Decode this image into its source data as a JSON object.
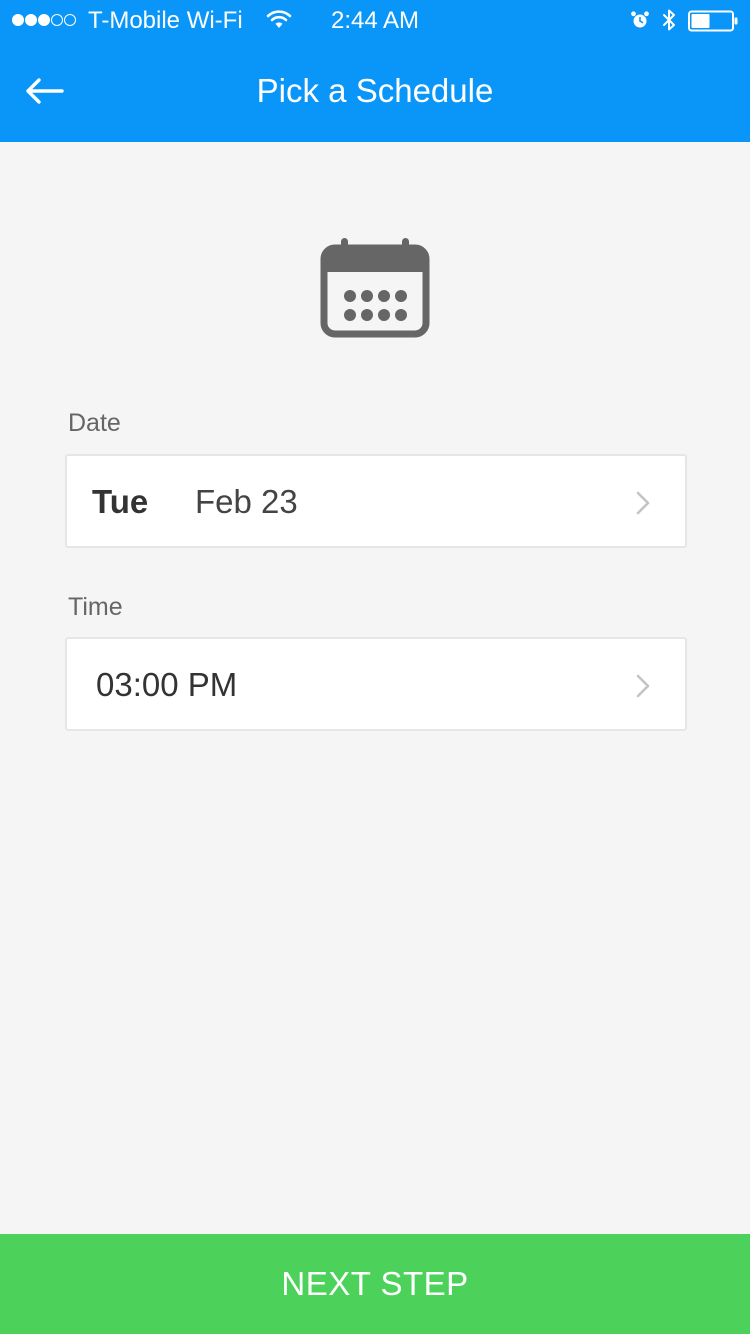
{
  "status_bar": {
    "carrier": "T-Mobile Wi-Fi",
    "time": "2:44 AM",
    "signal_dots_filled": 3,
    "signal_dots_total": 5
  },
  "header": {
    "title": "Pick a Schedule",
    "background_color": "#0996f8"
  },
  "schedule": {
    "date": {
      "label": "Date",
      "day": "Tue",
      "value": "Feb 23"
    },
    "time": {
      "label": "Time",
      "value": "03:00 PM"
    }
  },
  "footer": {
    "next_step_label": "NEXT STEP",
    "background_color": "#4cd25a"
  },
  "icons": [
    "wifi-icon",
    "alarm-icon",
    "bluetooth-icon",
    "battery-icon",
    "back-arrow-icon",
    "calendar-icon",
    "chevron-right-icon"
  ]
}
